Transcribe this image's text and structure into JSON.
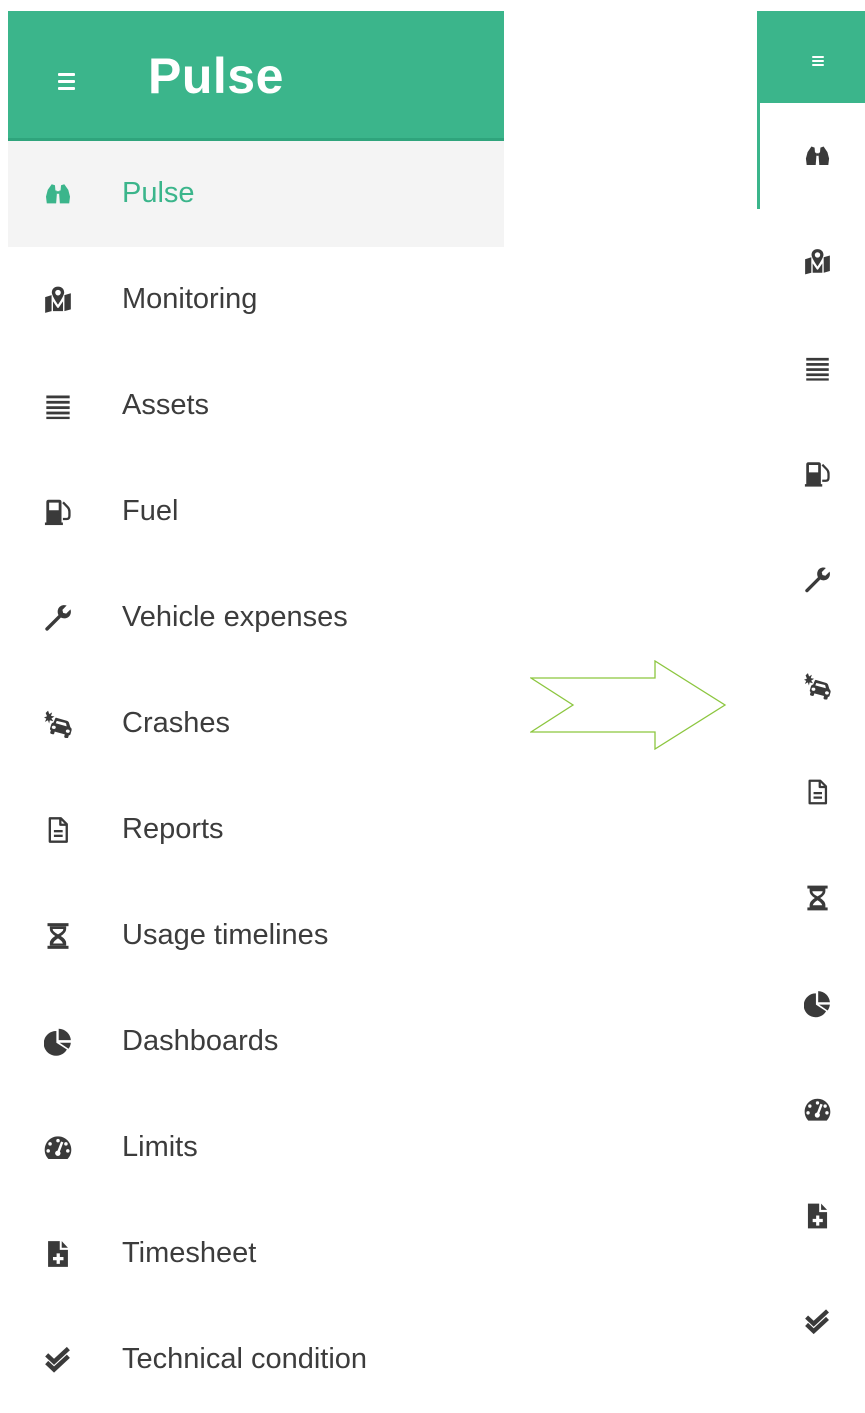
{
  "app": {
    "title": "Pulse"
  },
  "nav": [
    {
      "label": "Pulse",
      "icon": "binoculars-icon",
      "active": true
    },
    {
      "label": "Monitoring",
      "icon": "map-marker-icon",
      "active": false
    },
    {
      "label": "Assets",
      "icon": "list-icon",
      "active": false
    },
    {
      "label": "Fuel",
      "icon": "fuel-pump-icon",
      "active": false
    },
    {
      "label": "Vehicle expenses",
      "icon": "wrench-icon",
      "active": false
    },
    {
      "label": "Crashes",
      "icon": "car-crash-icon",
      "active": false
    },
    {
      "label": "Reports",
      "icon": "document-icon",
      "active": false
    },
    {
      "label": "Usage timelines",
      "icon": "hourglass-icon",
      "active": false
    },
    {
      "label": "Dashboards",
      "icon": "pie-chart-icon",
      "active": false
    },
    {
      "label": "Limits",
      "icon": "speedometer-icon",
      "active": false
    },
    {
      "label": "Timesheet",
      "icon": "file-plus-icon",
      "active": false
    },
    {
      "label": "Technical condition",
      "icon": "double-check-icon",
      "active": false
    }
  ],
  "colors": {
    "accent": "#3bb58b",
    "icon": "#3a3a3a",
    "text": "#3c3c3c",
    "active_bg": "#f4f4f4",
    "arrow": "#8cc63f"
  }
}
